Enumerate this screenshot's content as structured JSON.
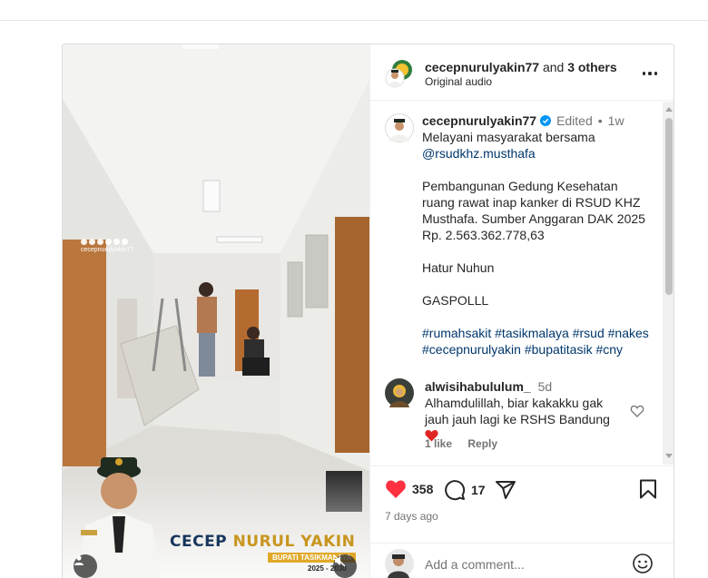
{
  "header": {
    "username": "cecepnurulyakin77",
    "and_text": "and",
    "others": "3 others",
    "audio": "Original audio"
  },
  "media": {
    "watermark_handle": "cecepnurulyakin77",
    "banner_name_part1": "CECEP",
    "banner_name_part2": "NURUL YAKIN",
    "banner_role": "BUPATI TASIKMALAYA",
    "banner_years": "2025 - 2030"
  },
  "caption": {
    "username": "cecepnurulyakin77",
    "edited": "Edited",
    "separator": "•",
    "age": "1w",
    "lines": [
      "Melayani masyarakat bersama",
      "@rsudkhz.musthafa",
      "",
      "Pembangunan Gedung Kesehatan",
      "ruang rawat inap kanker di RSUD KHZ",
      "Musthafa. Sumber Anggaran DAK 2025",
      "Rp. 2.563.362.778,63",
      "",
      "Hatur Nuhun",
      "",
      "GASPOLLL",
      "",
      "#rumahsakit #tasikmalaya #rsud #nakes",
      "#cecepnurulyakin #bupatitasik #cny"
    ]
  },
  "comment": {
    "username": "alwisihabululum_",
    "age": "5d",
    "text": "Alhamdulillah, biar kakakku gak jauh jauh lagi ke RSHS Bandung",
    "likes": "1 like",
    "reply": "Reply"
  },
  "actions": {
    "likes_count": "358",
    "comments_count": "17",
    "timestamp": "7 days ago"
  },
  "add_comment": {
    "placeholder": "Add a comment..."
  },
  "colors": {
    "like_red": "#ff3040",
    "link_blue": "#00376b",
    "verified_blue": "#0095f6",
    "muted_text": "#737373"
  },
  "icons": [
    "more-icon",
    "verified-icon",
    "heart-icon",
    "comment-icon",
    "share-icon",
    "bookmark-icon",
    "emoji-icon",
    "user-tag-icon",
    "mute-icon"
  ]
}
